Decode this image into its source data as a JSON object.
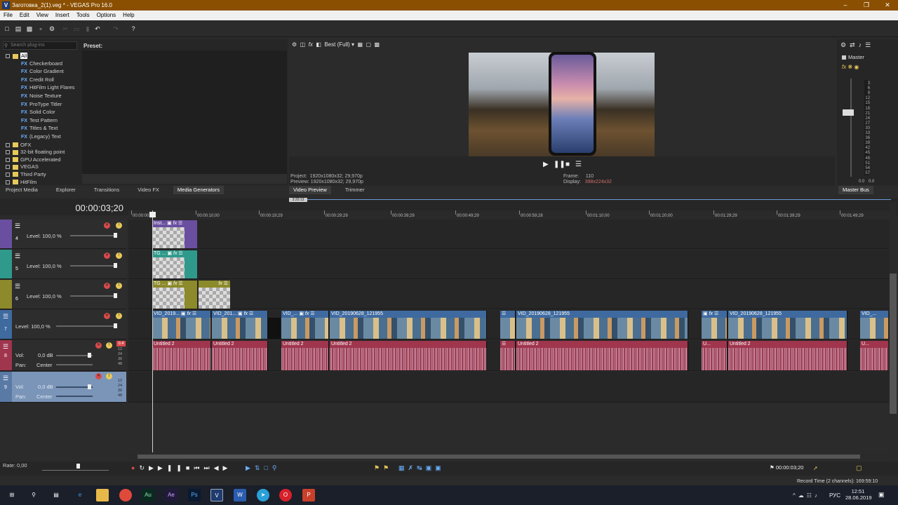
{
  "window": {
    "title": "Заготовка_2(1).veg * - VEGAS Pro 16.0",
    "app_icon": "V"
  },
  "menu": [
    "File",
    "Edit",
    "View",
    "Insert",
    "Tools",
    "Options",
    "Help"
  ],
  "left": {
    "search_placeholder": "Search plug-ins",
    "preset_label": "Preset:",
    "tree_root": "All",
    "fx_items": [
      "Checkerboard",
      "Color Gradient",
      "Credit Roll",
      "HitFilm Light Flares",
      "Noise Texture",
      "ProType Titler",
      "Solid Color",
      "Test Pattern",
      "Titles & Text",
      "(Legacy) Text"
    ],
    "fx_badge": "FX",
    "folders": [
      "OFX",
      "32-bit floating point",
      "GPU Accelerated",
      "VEGAS",
      "Third Party",
      "HitFilm"
    ],
    "tabs": [
      "Project Media",
      "Explorer",
      "Transitions",
      "Video FX",
      "Media Generators"
    ]
  },
  "preview": {
    "quality": "Best (Full)",
    "project_label": "Project:",
    "project_value": "1920x1080x32; 29,970p",
    "preview_label": "Preview:",
    "preview_value": "1920x1080x32; 29,970p",
    "frame_label": "Frame:",
    "frame_value": "110",
    "display_label": "Display:",
    "display_value": "398x224x32",
    "tabs": [
      "Video Preview",
      "Trimmer"
    ]
  },
  "mixer": {
    "label": "Master",
    "tab": "Master Bus",
    "scale": [
      "3",
      "6",
      "9",
      "12",
      "15",
      "18",
      "21",
      "24",
      "27",
      "30",
      "33",
      "36",
      "39",
      "42",
      "45",
      "48",
      "51",
      "54",
      "57"
    ],
    "left_value": "0.0",
    "right_value": "0.0"
  },
  "timeline": {
    "timecode": "00:00:03;20",
    "ruler_label": "3:20:13",
    "ticks": [
      "00:00:00;00",
      "00:00:10;00",
      "00:00:19;29",
      "00:00:29;29",
      "00:00:39;29",
      "00:00:49;29",
      "00:00:59;28",
      "00:01:10;00",
      "00:01:20;00",
      "00:01:29;29",
      "00:01:39;29",
      "00:01:49;29"
    ],
    "tracks": [
      {
        "num": "4",
        "level": "Level: 100,0 %",
        "color": "#6a4fa0"
      },
      {
        "num": "5",
        "level": "Level: 100,0 %",
        "color": "#2f9a8c"
      },
      {
        "num": "6",
        "level": "Level: 100,0 %",
        "color": "#8c8a2a"
      },
      {
        "num": "7",
        "level": "Level: 100,0 %",
        "color": "#3f6aa0"
      }
    ],
    "audio_tracks": [
      {
        "num": "8",
        "vol_label": "Vol:",
        "vol": "0,0 dB",
        "pan_label": "Pan:",
        "pan": "Center",
        "color": "#a0354e",
        "meter": [
          "12",
          "24",
          "36",
          "48"
        ],
        "peak": "0.4"
      },
      {
        "num": "9",
        "vol_label": "Vol:",
        "vol": "0,0 dB",
        "pan_label": "Pan:",
        "pan": "Center",
        "color": "#5a7aa6",
        "meter": [
          "12",
          "24",
          "36",
          "48"
        ]
      }
    ],
    "clips": {
      "t4": "Inst...",
      "t5": "TG ...",
      "t6": "TG ...",
      "video": [
        "VID_2019...",
        "VID_201...",
        "VID_...",
        "VID_20190628_121955",
        "VID_20190628_121955",
        "VID_20190628_121955",
        "VID_..."
      ],
      "audio": [
        "Untitled 2",
        "Untitled 2",
        "Untitled 2",
        "Untitled 2",
        "Untitled 2",
        "Untitled 2",
        "U...",
        "Untitled 2",
        "U..."
      ]
    }
  },
  "transport": {
    "rate": "Rate: 0,00",
    "end_time": "00:00:03;20"
  },
  "status": {
    "record_time": "Record Time (2 channels): 169:59:10"
  },
  "taskbar": {
    "lang": "РУС",
    "time": "12:51",
    "date": "28.06.2019"
  }
}
